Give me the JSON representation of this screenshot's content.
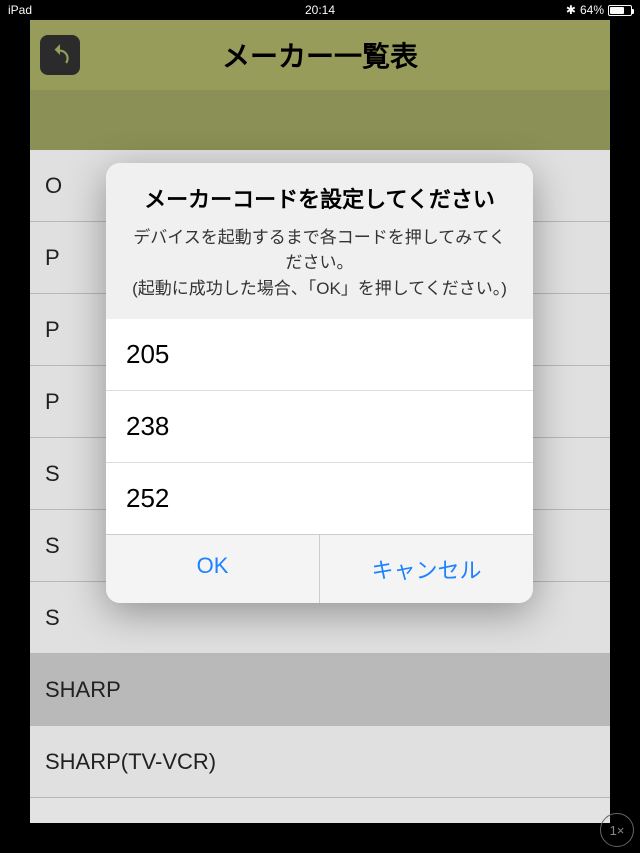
{
  "status": {
    "device": "iPad",
    "time": "20:14",
    "bluetooth": "✱",
    "battery": "64%"
  },
  "header": {
    "title": "メーカー一覧表"
  },
  "list": [
    {
      "label": "O",
      "highlight": false
    },
    {
      "label": "P",
      "highlight": false
    },
    {
      "label": "P",
      "highlight": false
    },
    {
      "label": "P",
      "highlight": false
    },
    {
      "label": "S",
      "highlight": false
    },
    {
      "label": "S",
      "highlight": false
    },
    {
      "label": "S",
      "highlight": false
    },
    {
      "label": "SHARP",
      "highlight": true
    },
    {
      "label": "SHARP(TV-VCR)",
      "highlight": false
    }
  ],
  "dialog": {
    "title": "メーカーコードを設定してください",
    "message_line1": "デバイスを起動するまで各コードを押してみてください。",
    "message_line2": "(起動に成功した場合、「OK」を押してください。)",
    "options": [
      "205",
      "238",
      "252"
    ],
    "ok_label": "OK",
    "cancel_label": "キャンセル"
  },
  "zoom": "1×"
}
